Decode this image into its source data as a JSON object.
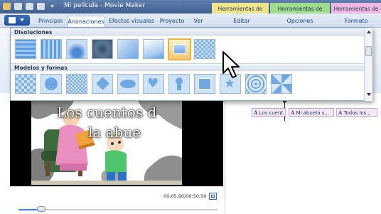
{
  "window": {
    "title": "Mi película - Movie Maker",
    "context_groups": [
      {
        "label": "Herramientas de vídeo",
        "color": "#f1e58b"
      },
      {
        "label": "Herramientas de música",
        "color": "#9fdb8a"
      },
      {
        "label": "Herramientas de texto",
        "color": "#f0b8e0"
      }
    ]
  },
  "ribbon": {
    "file_menu": "file-menu",
    "tabs": [
      "Principal",
      "Animaciones",
      "Efectos visuales",
      "Proyecto",
      "Ver",
      "Editar",
      "Opciones",
      "Formato"
    ],
    "active_tab": "Animaciones"
  },
  "gallery": {
    "sections": [
      {
        "title": "Disoluciones"
      },
      {
        "title": "Modelos y formas"
      }
    ]
  },
  "preview": {
    "caption_line1": "Los cuentos d",
    "caption_line2": "la abue",
    "timecode": "00:05,90/00:50,50",
    "seek_position": 0.12
  },
  "storyboard": {
    "clips": [
      "Los cuent...",
      "Mi abuela s...",
      "Todos los..."
    ],
    "clip_icon": "A"
  },
  "colors": {
    "accent": "#3b80d8",
    "selection": "#e7b44b",
    "title_bar": "#4a6a9e"
  }
}
